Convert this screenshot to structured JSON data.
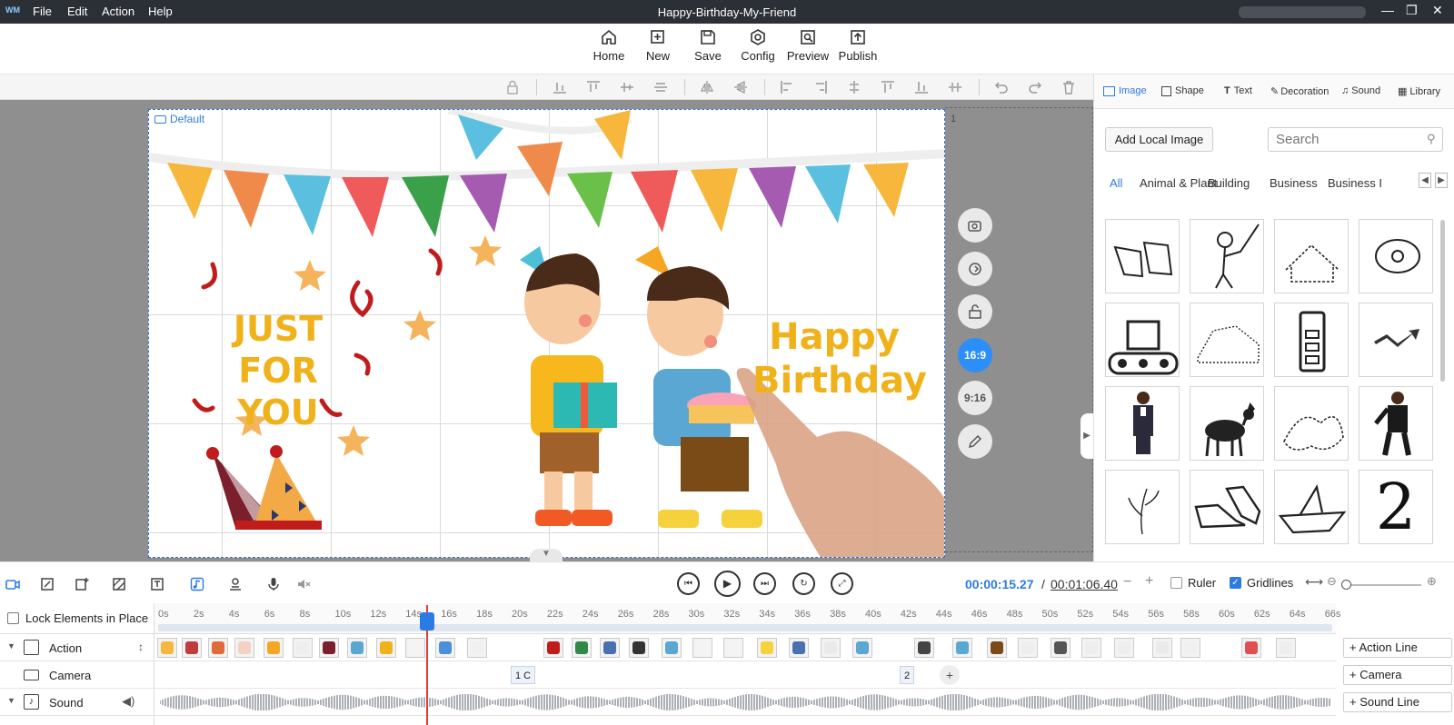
{
  "window": {
    "title": "Happy-Birthday-My-Friend",
    "logo_text": "WM",
    "menu": [
      "File",
      "Edit",
      "Action",
      "Help"
    ]
  },
  "toolbar": {
    "buttons": [
      {
        "label": "Home",
        "icon": "home-icon"
      },
      {
        "label": "New",
        "icon": "new-scene-icon"
      },
      {
        "label": "Save",
        "icon": "save-icon"
      },
      {
        "label": "Config",
        "icon": "config-icon"
      },
      {
        "label": "Preview",
        "icon": "preview-icon"
      },
      {
        "label": "Publish",
        "icon": "publish-icon"
      }
    ]
  },
  "canvas": {
    "camera_label": "Default",
    "next_camera_number": "1",
    "texts": {
      "left_line1": "JUST FOR",
      "left_line2": "YOU",
      "right_line1": "Happy",
      "right_line2": "Birthday"
    },
    "side_tools": [
      {
        "icon": "camera-add-icon"
      },
      {
        "icon": "rotate-icon"
      },
      {
        "icon": "unlock-icon"
      },
      {
        "label": "16:9",
        "active": true
      },
      {
        "label": "9:16"
      },
      {
        "icon": "pen-icon"
      }
    ]
  },
  "right_panel": {
    "tabs": [
      "Image",
      "Shape",
      "Text",
      "Decoration",
      "Sound",
      "Library"
    ],
    "active_tab": "Image",
    "add_button": "Add Local Image",
    "search_placeholder": "Search",
    "categories": [
      "All",
      "Animal & Plant",
      "Building",
      "Business",
      "Business I"
    ],
    "active_category": "All",
    "digit_thumb": "2"
  },
  "timeline": {
    "current_time": "00:00:15.27",
    "separator": "/",
    "total_time": "00:01:06.40",
    "ruler_label": "Ruler",
    "ruler_checked": false,
    "gridlines_label": "Gridlines",
    "gridlines_checked": true,
    "lock_label": "Lock Elements in Place",
    "ticks": [
      "0s",
      "2s",
      "4s",
      "6s",
      "8s",
      "10s",
      "12s",
      "14s",
      "16s",
      "18s",
      "20s",
      "22s",
      "24s",
      "26s",
      "28s",
      "30s",
      "32s",
      "34s",
      "36s",
      "38s",
      "40s",
      "42s",
      "44s",
      "46s",
      "48s",
      "50s",
      "52s",
      "54s",
      "56s",
      "58s",
      "60s",
      "62s",
      "64s",
      "66s"
    ],
    "tracks": [
      "Action",
      "Camera",
      "Sound"
    ],
    "camera_markers": [
      "1 C",
      "2"
    ],
    "add_buttons": [
      "+ Action Line",
      "+ Camera",
      "+ Sound Line"
    ]
  },
  "colors": {
    "accent": "#2c7be5",
    "titlebar": "#2b2f36",
    "workarea": "#8f8f8f",
    "text_orange": "#f0b21a",
    "playhead": "#e23b3b"
  }
}
